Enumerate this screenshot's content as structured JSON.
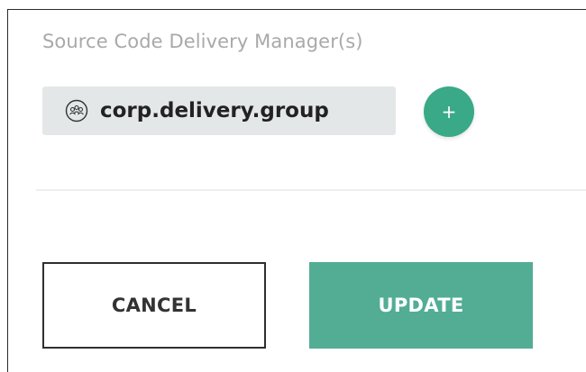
{
  "managers": {
    "label": "Source Code Delivery Manager(s)",
    "items": [
      {
        "name": "corp.delivery.group",
        "icon": "group-icon"
      }
    ],
    "add_label": "+"
  },
  "actions": {
    "cancel_label": "CANCEL",
    "update_label": "UPDATE"
  },
  "colors": {
    "accent": "#3aa988",
    "update_button": "#52ad94",
    "chip_background": "#e4e7e8",
    "label_text": "#a9a9a9"
  }
}
